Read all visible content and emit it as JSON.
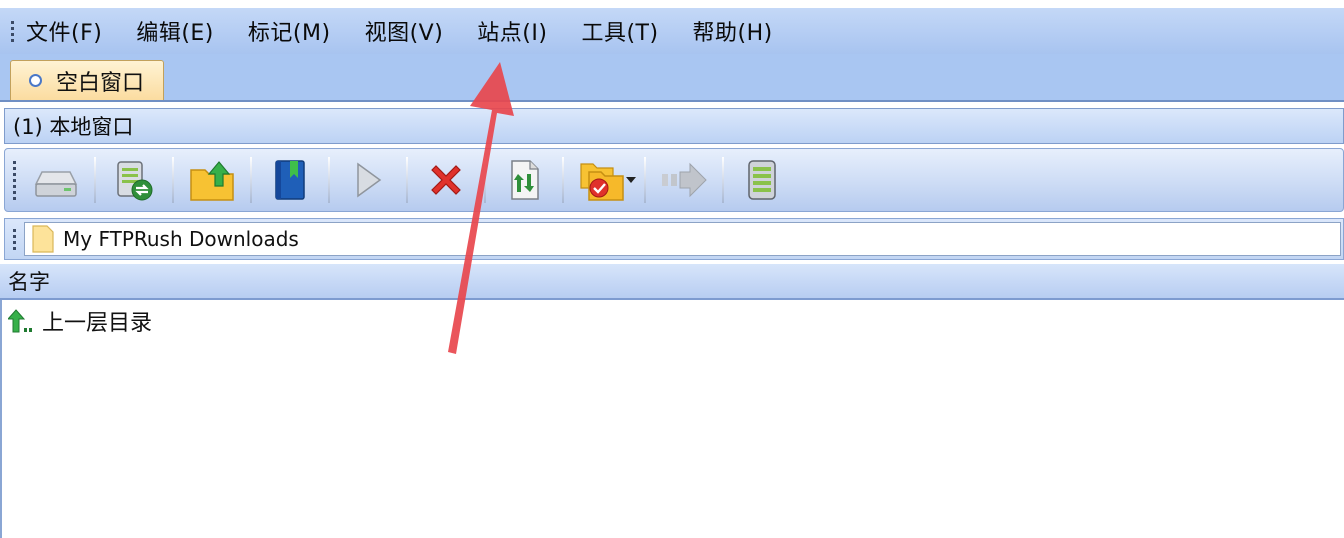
{
  "menu": {
    "items": [
      "文件(F)",
      "编辑(E)",
      "标记(M)",
      "视图(V)",
      "站点(I)",
      "工具(T)",
      "帮助(H)"
    ]
  },
  "tabs": [
    {
      "label": "空白窗口",
      "active": true
    }
  ],
  "local_window": {
    "title": "(1) 本地窗口"
  },
  "toolbar": {
    "buttons": [
      {
        "icon": "drive-icon"
      },
      {
        "icon": "refresh-drive-icon"
      },
      {
        "icon": "folder-up-icon"
      },
      {
        "icon": "bookmark-icon"
      },
      {
        "icon": "play-icon"
      },
      {
        "icon": "delete-icon"
      },
      {
        "icon": "transfer-file-icon"
      },
      {
        "icon": "folder-filter-icon"
      },
      {
        "icon": "forward-arrow-icon"
      },
      {
        "icon": "server-list-icon"
      }
    ]
  },
  "address_bar": {
    "path": "My FTPRush Downloads",
    "icon": "folder-icon"
  },
  "file_list": {
    "columns": [
      "名字"
    ],
    "rows": [
      {
        "name": "上一层目录",
        "icon": "parent-dir-icon"
      }
    ]
  },
  "colors": {
    "menubar_bg": "#b2cbf3",
    "tab_active_bg": "#fde7b6",
    "annotation_arrow": "#e8474d"
  }
}
